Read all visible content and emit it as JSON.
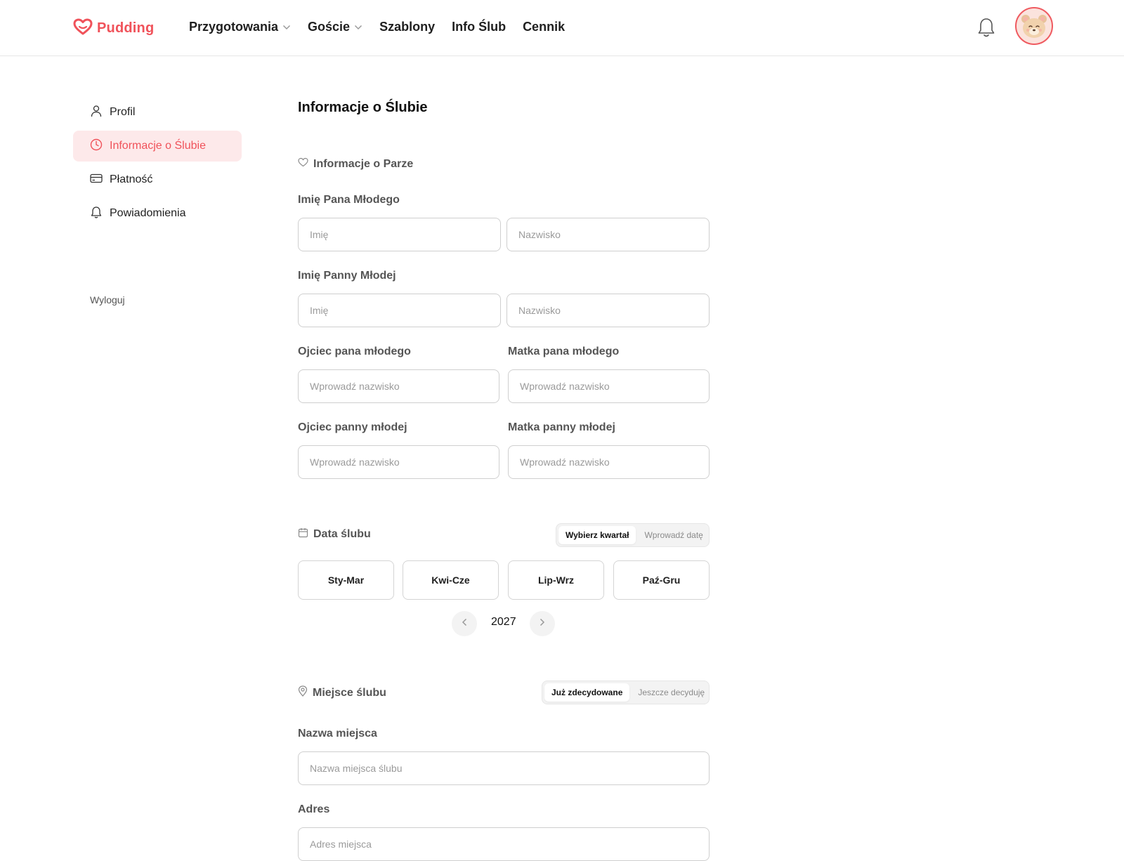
{
  "header": {
    "logo_text": "Pudding",
    "brand_color": "#f0525a",
    "nav": [
      {
        "label": "Przygotowania",
        "dropdown": true
      },
      {
        "label": "Goście",
        "dropdown": true
      },
      {
        "label": "Szablony",
        "dropdown": false
      },
      {
        "label": "Info Ślub",
        "dropdown": false
      },
      {
        "label": "Cennik",
        "dropdown": false
      }
    ],
    "icons": {
      "notifications": "bell-icon",
      "avatar": "bear-avatar"
    }
  },
  "sidebar": {
    "items": [
      {
        "label": "Profil",
        "icon": "user-icon",
        "active": false
      },
      {
        "label": "Informacje o Ślubie",
        "icon": "clock-icon",
        "active": true
      },
      {
        "label": "Płatność",
        "icon": "credit-card-icon",
        "active": false
      },
      {
        "label": "Powiadomienia",
        "icon": "bell-icon",
        "active": false
      }
    ],
    "logout": "Wyloguj"
  },
  "main": {
    "title": "Informacje o Ślubie",
    "couple": {
      "heading": "Informacje o Parze",
      "groom_label": "Imię Pana Młodego",
      "groom_first_placeholder": "Imię",
      "groom_last_placeholder": "Nazwisko",
      "bride_label": "Imię Panny Młodej",
      "bride_first_placeholder": "Imię",
      "bride_last_placeholder": "Nazwisko",
      "groom_father_label": "Ojciec pana młodego",
      "groom_mother_label": "Matka pana młodego",
      "bride_father_label": "Ojciec panny młodej",
      "bride_mother_label": "Matka panny młodej",
      "parent_placeholder": "Wprowadź nazwisko"
    },
    "date": {
      "heading": "Data ślubu",
      "toggle": [
        "Wybierz kwartał",
        "Wprowadź datę"
      ],
      "toggle_selected": "Wybierz kwartał",
      "quarters": [
        "Sty-Mar",
        "Kwi-Cze",
        "Lip-Wrz",
        "Paź-Gru"
      ],
      "year": "2027"
    },
    "venue": {
      "heading": "Miejsce ślubu",
      "toggle": [
        "Już zdecydowane",
        "Jeszcze decyduję"
      ],
      "toggle_selected": "Już zdecydowane",
      "name_label": "Nazwa miejsca",
      "name_placeholder": "Nazwa miejsca ślubu",
      "address_label": "Adres",
      "address_placeholder": "Adres miejsca"
    }
  }
}
